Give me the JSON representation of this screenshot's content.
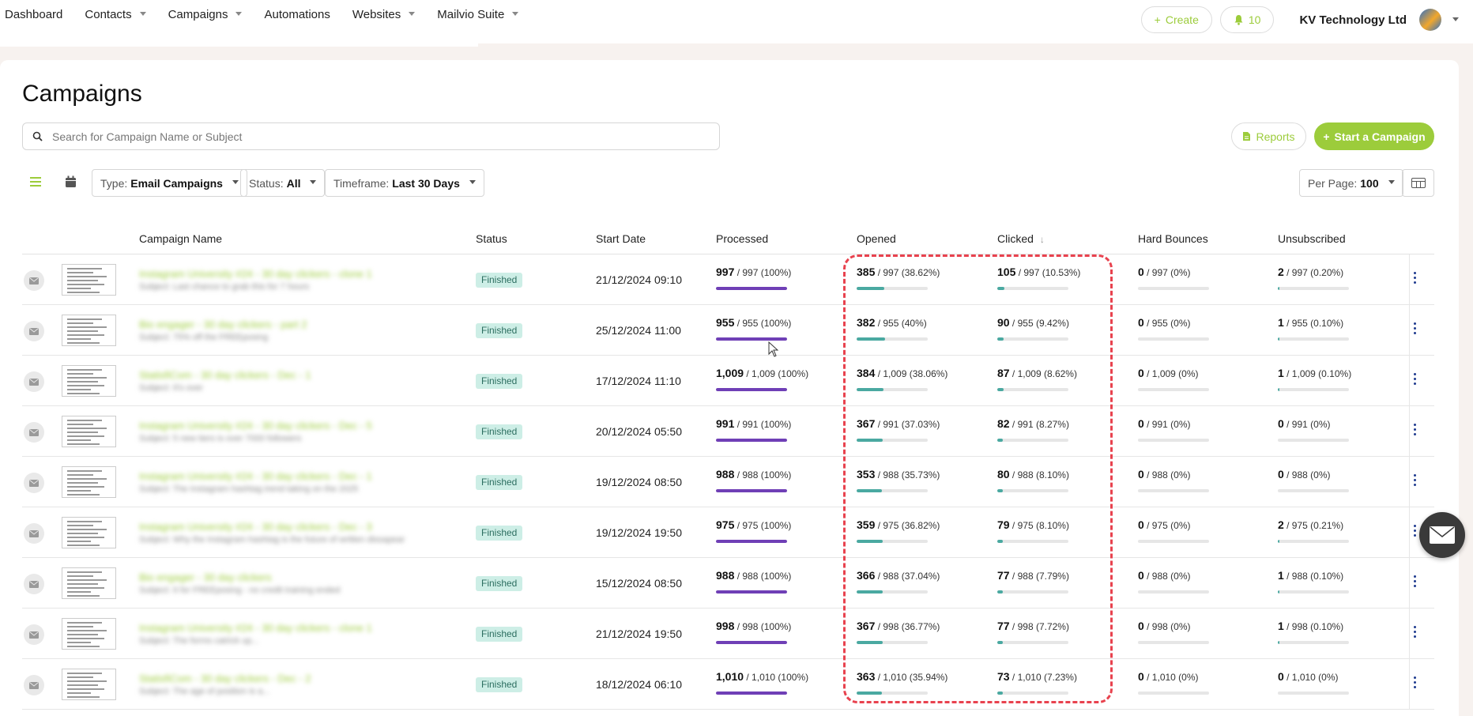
{
  "nav": {
    "items": [
      {
        "label": "Dashboard",
        "dropdown": false
      },
      {
        "label": "Contacts",
        "dropdown": true
      },
      {
        "label": "Campaigns",
        "dropdown": true,
        "active": true
      },
      {
        "label": "Automations",
        "dropdown": false
      },
      {
        "label": "Websites",
        "dropdown": true
      },
      {
        "label": "Mailvio Suite",
        "dropdown": true
      }
    ],
    "create_label": "Create",
    "notification_count": "10",
    "company": "KV Technology Ltd"
  },
  "page": {
    "title": "Campaigns",
    "search_placeholder": "Search for Campaign Name or Subject",
    "reports_label": "Reports",
    "start_label": "Start a Campaign"
  },
  "filters": {
    "type": {
      "prefix": "Type:",
      "value": "Email Campaigns"
    },
    "status": {
      "prefix": "Status:",
      "value": "All"
    },
    "timeframe": {
      "prefix": "Timeframe:",
      "value": "Last 30 Days"
    },
    "per_page": {
      "prefix": "Per Page:",
      "value": "100"
    }
  },
  "table": {
    "headers": {
      "name": "Campaign Name",
      "status": "Status",
      "start_date": "Start Date",
      "processed": "Processed",
      "opened": "Opened",
      "clicked": "Clicked",
      "bounces": "Hard Bounces",
      "unsubscribed": "Unsubscribed"
    },
    "rows": [
      {
        "name": "Instagram University #24 - 30 day clickers - clone 1",
        "subject": "Subject: Last chance to grab this for 7 hours",
        "status": "Finished",
        "start": "21/12/2024 09:10",
        "processed": {
          "n": "997",
          "rest": "/ 997 (100%)",
          "pct": 100
        },
        "opened": {
          "n": "385",
          "rest": "/ 997 (38.62%)",
          "pct": 38.62
        },
        "clicked": {
          "n": "105",
          "rest": "/ 997 (10.53%)",
          "pct": 10.53
        },
        "bounces": {
          "n": "0",
          "rest": "/ 997 (0%)",
          "pct": 0
        },
        "unsub": {
          "n": "2",
          "rest": "/ 997 (0.20%)",
          "pct": 0.2
        }
      },
      {
        "name": "Bio engager - 30 day clickers - part 2",
        "subject": "Subject: 75% off the FREEposing",
        "status": "Finished",
        "start": "25/12/2024 11:00",
        "processed": {
          "n": "955",
          "rest": "/ 955 (100%)",
          "pct": 100
        },
        "opened": {
          "n": "382",
          "rest": "/ 955 (40%)",
          "pct": 40
        },
        "clicked": {
          "n": "90",
          "rest": "/ 955 (9.42%)",
          "pct": 9.42
        },
        "bounces": {
          "n": "0",
          "rest": "/ 955 (0%)",
          "pct": 0
        },
        "unsub": {
          "n": "1",
          "rest": "/ 955 (0.10%)",
          "pct": 0.1
        }
      },
      {
        "name": "StatisfiCom - 30 day clickers - Dec - 1",
        "subject": "Subject: It's over",
        "status": "Finished",
        "start": "17/12/2024 11:10",
        "processed": {
          "n": "1,009",
          "rest": "/ 1,009 (100%)",
          "pct": 100
        },
        "opened": {
          "n": "384",
          "rest": "/ 1,009 (38.06%)",
          "pct": 38.06
        },
        "clicked": {
          "n": "87",
          "rest": "/ 1,009 (8.62%)",
          "pct": 8.62
        },
        "bounces": {
          "n": "0",
          "rest": "/ 1,009 (0%)",
          "pct": 0
        },
        "unsub": {
          "n": "1",
          "rest": "/ 1,009 (0.10%)",
          "pct": 0.1
        }
      },
      {
        "name": "Instagram University #24 - 30 day clickers - Dec - 5",
        "subject": "Subject: 5 new tiers is over 7000 followers",
        "status": "Finished",
        "start": "20/12/2024 05:50",
        "processed": {
          "n": "991",
          "rest": "/ 991 (100%)",
          "pct": 100
        },
        "opened": {
          "n": "367",
          "rest": "/ 991 (37.03%)",
          "pct": 37.03
        },
        "clicked": {
          "n": "82",
          "rest": "/ 991 (8.27%)",
          "pct": 8.27
        },
        "bounces": {
          "n": "0",
          "rest": "/ 991 (0%)",
          "pct": 0
        },
        "unsub": {
          "n": "0",
          "rest": "/ 991 (0%)",
          "pct": 0
        }
      },
      {
        "name": "Instagram University #24 - 30 day clickers - Dec - 1",
        "subject": "Subject: The Instagram hashtag trend taking on the 2025",
        "status": "Finished",
        "start": "19/12/2024 08:50",
        "processed": {
          "n": "988",
          "rest": "/ 988 (100%)",
          "pct": 100
        },
        "opened": {
          "n": "353",
          "rest": "/ 988 (35.73%)",
          "pct": 35.73
        },
        "clicked": {
          "n": "80",
          "rest": "/ 988 (8.10%)",
          "pct": 8.1
        },
        "bounces": {
          "n": "0",
          "rest": "/ 988 (0%)",
          "pct": 0
        },
        "unsub": {
          "n": "0",
          "rest": "/ 988 (0%)",
          "pct": 0
        }
      },
      {
        "name": "Instagram University #24 - 30 day clickers - Dec - 3",
        "subject": "Subject: Why the Instagram hashtag is the future of written dissapear",
        "status": "Finished",
        "start": "19/12/2024 19:50",
        "processed": {
          "n": "975",
          "rest": "/ 975 (100%)",
          "pct": 100
        },
        "opened": {
          "n": "359",
          "rest": "/ 975 (36.82%)",
          "pct": 36.82
        },
        "clicked": {
          "n": "79",
          "rest": "/ 975 (8.10%)",
          "pct": 8.1
        },
        "bounces": {
          "n": "0",
          "rest": "/ 975 (0%)",
          "pct": 0
        },
        "unsub": {
          "n": "2",
          "rest": "/ 975 (0.21%)",
          "pct": 0.21
        }
      },
      {
        "name": "Bio engager - 30 day clickers",
        "subject": "Subject: It for FREEposing - no credit training ended",
        "status": "Finished",
        "start": "15/12/2024 08:50",
        "processed": {
          "n": "988",
          "rest": "/ 988 (100%)",
          "pct": 100
        },
        "opened": {
          "n": "366",
          "rest": "/ 988 (37.04%)",
          "pct": 37.04
        },
        "clicked": {
          "n": "77",
          "rest": "/ 988 (7.79%)",
          "pct": 7.79
        },
        "bounces": {
          "n": "0",
          "rest": "/ 988 (0%)",
          "pct": 0
        },
        "unsub": {
          "n": "1",
          "rest": "/ 988 (0.10%)",
          "pct": 0.1
        }
      },
      {
        "name": "Instagram University #24 - 30 day clickers - clone 1",
        "subject": "Subject: The forms catrick up...",
        "status": "Finished",
        "start": "21/12/2024 19:50",
        "processed": {
          "n": "998",
          "rest": "/ 998 (100%)",
          "pct": 100
        },
        "opened": {
          "n": "367",
          "rest": "/ 998 (36.77%)",
          "pct": 36.77
        },
        "clicked": {
          "n": "77",
          "rest": "/ 998 (7.72%)",
          "pct": 7.72
        },
        "bounces": {
          "n": "0",
          "rest": "/ 998 (0%)",
          "pct": 0
        },
        "unsub": {
          "n": "1",
          "rest": "/ 998 (0.10%)",
          "pct": 0.1
        }
      },
      {
        "name": "StatisfiCom - 30 day clickers - Dec - 2",
        "subject": "Subject: The age of position is a...",
        "status": "Finished",
        "start": "18/12/2024 06:10",
        "processed": {
          "n": "1,010",
          "rest": "/ 1,010 (100%)",
          "pct": 100
        },
        "opened": {
          "n": "363",
          "rest": "/ 1,010 (35.94%)",
          "pct": 35.94
        },
        "clicked": {
          "n": "73",
          "rest": "/ 1,010 (7.23%)",
          "pct": 7.23
        },
        "bounces": {
          "n": "0",
          "rest": "/ 1,010 (0%)",
          "pct": 0
        },
        "unsub": {
          "n": "0",
          "rest": "/ 1,010 (0%)",
          "pct": 0
        }
      }
    ]
  },
  "colors": {
    "accent": "#9ccc3b",
    "processed_bar": "#6f3fb6",
    "rate_bar": "#4aa9a1",
    "highlight_dashed": "#e8424e"
  },
  "icons": [
    "search-icon",
    "document-icon",
    "plus-icon",
    "bell-icon",
    "list-view-icon",
    "calendar-icon",
    "columns-icon",
    "envelope-icon",
    "kebab-menu-icon",
    "sort-down-icon",
    "chat-icon"
  ]
}
